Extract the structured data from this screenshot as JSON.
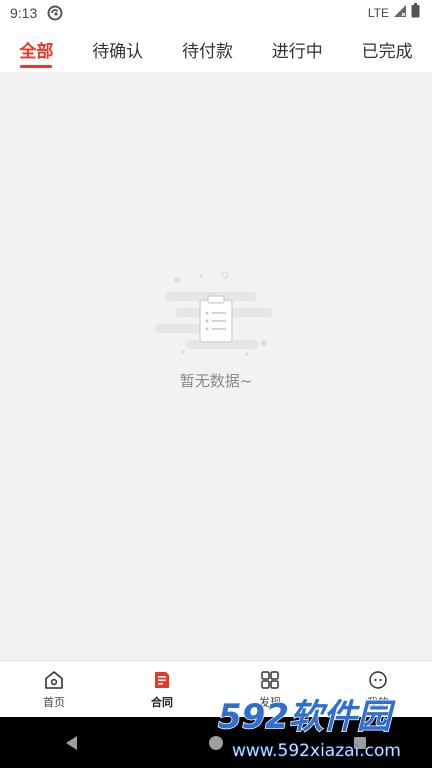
{
  "status_bar": {
    "time": "9:13",
    "network": "LTE"
  },
  "tabs": [
    {
      "label": "全部",
      "active": true
    },
    {
      "label": "待确认",
      "active": false
    },
    {
      "label": "待付款",
      "active": false
    },
    {
      "label": "进行中",
      "active": false
    },
    {
      "label": "已完成",
      "active": false
    }
  ],
  "empty_state": {
    "text": "暂无数据~",
    "icon": "clipboard-icon"
  },
  "bottom_nav": [
    {
      "label": "首页",
      "icon": "home-icon",
      "active": false
    },
    {
      "label": "合同",
      "icon": "contract-icon",
      "active": true
    },
    {
      "label": "发现",
      "icon": "grid-icon",
      "active": false
    },
    {
      "label": "我的",
      "icon": "smile-icon",
      "active": false
    }
  ],
  "watermark": {
    "brand": "592软件园",
    "url": "www.592xiazai.com"
  },
  "colors": {
    "accent": "#e8382b",
    "background": "#f2f2f2",
    "watermark_blue": "#2f6fd1"
  }
}
